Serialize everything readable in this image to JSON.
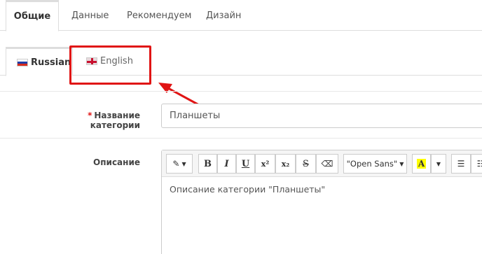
{
  "top_tabs": [
    {
      "label": "Общие",
      "active": true
    },
    {
      "label": "Данные",
      "active": false
    },
    {
      "label": "Рекомендуем",
      "active": false
    },
    {
      "label": "Дизайн",
      "active": false
    }
  ],
  "lang_tabs": [
    {
      "label": "Russian",
      "flag": "flag-ru-icon",
      "active": true
    },
    {
      "label": "English",
      "flag": "flag-gb-icon",
      "active": false
    }
  ],
  "form": {
    "name_label": "Название категории",
    "required_mark": "*",
    "name_value": "Планшеты",
    "description_label": "Описание"
  },
  "editor": {
    "font_select": "\"Open Sans\"",
    "color_letter": "A",
    "bold": "B",
    "italic": "I",
    "underline": "U",
    "superscript": "x²",
    "subscript": "x₂",
    "strike": "S",
    "content": "Описание категории \"Планшеты\""
  },
  "colors": {
    "highlight": "#e01414",
    "text_highlight": "#ffff00"
  }
}
